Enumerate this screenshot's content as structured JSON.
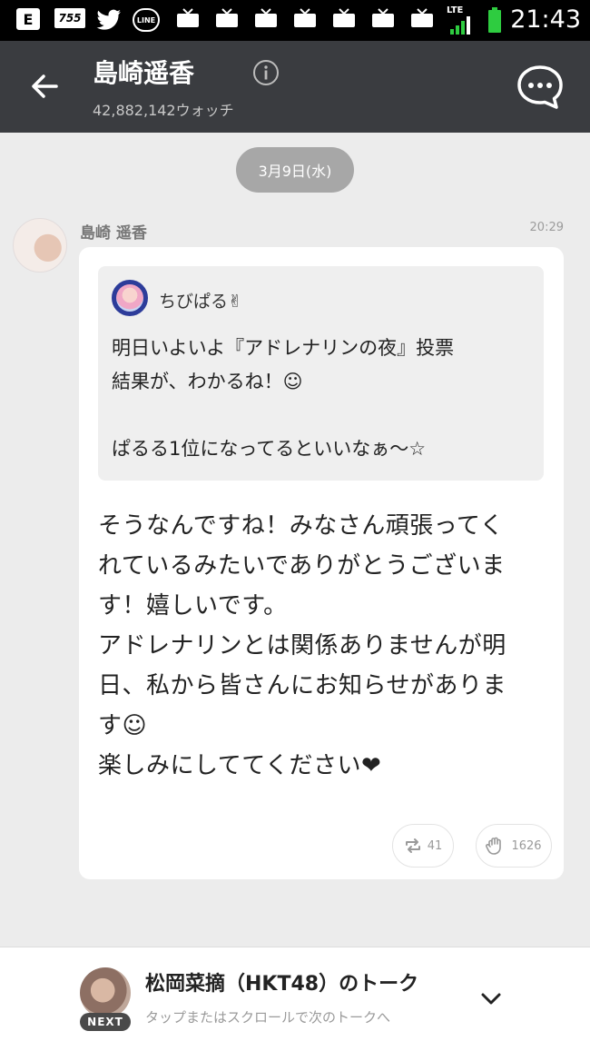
{
  "status_bar": {
    "icons": [
      "e-notify-icon",
      "755-app-icon",
      "twitter-icon",
      "line-app-icon",
      "tv-icon",
      "tv-icon",
      "tv-icon",
      "tv-icon",
      "tv-icon",
      "tv-icon",
      "tv-icon",
      "lte-signal-icon",
      "battery-icon"
    ],
    "e_label": "E",
    "app755_label": "755",
    "line_label": "LINE",
    "lte_label": "LTE",
    "time": "21:43"
  },
  "header": {
    "title": "島崎遥香",
    "watch_count": "42,882,142ウォッチ",
    "icons": [
      "back-arrow-icon",
      "info-icon",
      "comment-bubble-icon"
    ]
  },
  "timeline": {
    "date_label": "3月9日(水)",
    "post": {
      "author": "島崎 遥香",
      "time": "20:29",
      "quote": {
        "author": "ちびぱる✌",
        "text": "明日いよいよ『アドレナリンの夜』投票\n結果が、わかるね！☺\n\nぱるる1位になってるといいなぁ～☆"
      },
      "body": "そうなんですね！みなさん頑張ってく\nれているみたいでありがとうございま\nす！嬉しいです。\nアドレナリンとは関係ありませんが明\n日、私から皆さんにお知らせがありま\nす☺\n楽しみにしててください❤",
      "repost_count": "41",
      "like_count": "1626"
    }
  },
  "next_talk": {
    "badge": "NEXT",
    "title": "松岡菜摘（HKT48）のトーク",
    "subtitle": "タップまたはスクロールで次のトークへ"
  },
  "colors": {
    "header_bg": "#3a3c40",
    "page_bg": "#ececec",
    "card_bg": "#ffffff",
    "quote_bg": "#efefef",
    "date_pill_bg": "#a7a7a7"
  }
}
